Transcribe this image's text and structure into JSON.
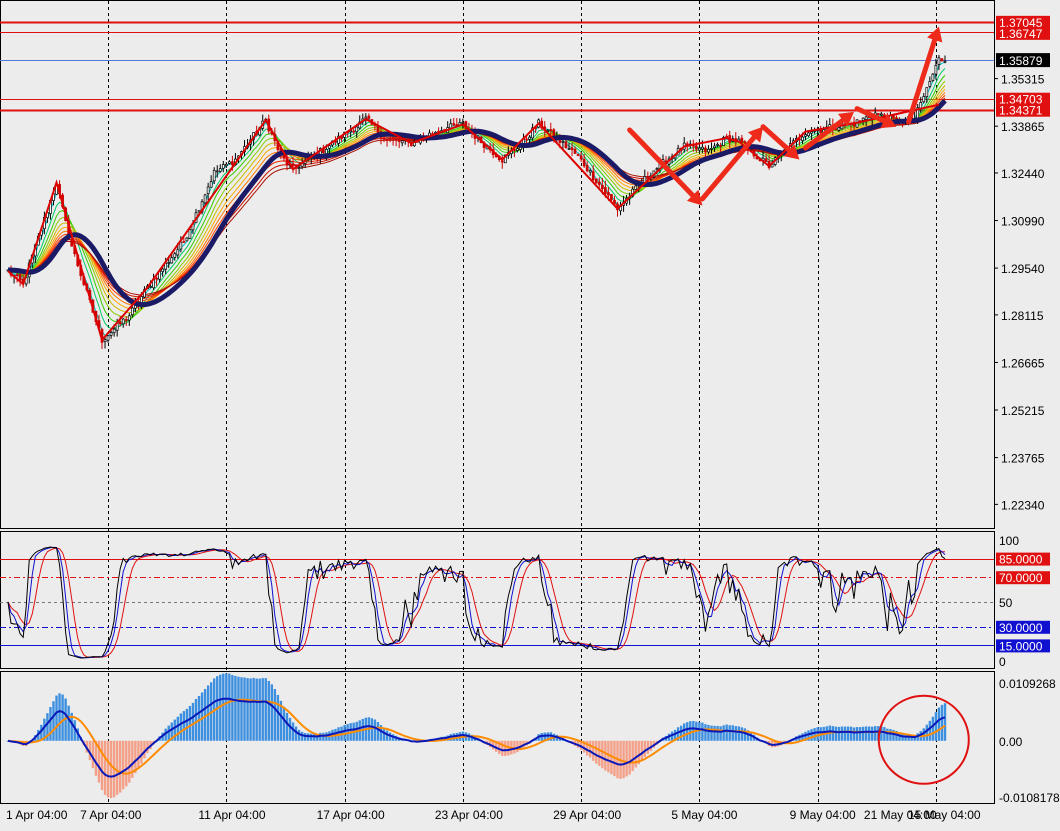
{
  "colors": {
    "background": "#ececec",
    "up_candle": "#000000",
    "down_candle": "#cc0000",
    "slow_ma": "#1a1a66",
    "zigzag": "#dd0000",
    "arrows": "#ee2a1a",
    "histogram_pos": "#3d8fe0",
    "histogram_neg": "#f4a088",
    "macd_line": "#0a18b8",
    "signal_line": "#ff8c00",
    "level_red": "#e01010",
    "level_blue": "#1010d0"
  },
  "price_panel": {
    "ylim": [
      1.2165,
      1.3765
    ],
    "tick_labels": [
      "1.35315",
      "1.33865",
      "1.32440",
      "1.30990",
      "1.29540",
      "1.28115",
      "1.26665",
      "1.25215",
      "1.23765",
      "1.22340"
    ],
    "tick_values": [
      1.35315,
      1.33865,
      1.3244,
      1.3099,
      1.2954,
      1.28115,
      1.26665,
      1.25215,
      1.23765,
      1.2234
    ],
    "current_price": {
      "label": "1.35879",
      "value": 1.35879
    },
    "levels": [
      {
        "label": "1.37045",
        "value": 1.37045
      },
      {
        "label": "1.36747",
        "value": 1.36747
      },
      {
        "label": "1.34703",
        "value": 1.34703
      },
      {
        "label": "1.34371",
        "value": 1.34371
      }
    ],
    "zigzag": [
      [
        0,
        1.2945
      ],
      [
        5,
        1.2905
      ],
      [
        16,
        1.3215
      ],
      [
        31,
        1.2735
      ],
      [
        46,
        1.2895
      ],
      [
        85,
        1.3405
      ],
      [
        94,
        1.3255
      ],
      [
        118,
        1.3408
      ],
      [
        133,
        1.3335
      ],
      [
        150,
        1.3392
      ],
      [
        163,
        1.3285
      ],
      [
        175,
        1.3395
      ],
      [
        201,
        1.3135
      ],
      [
        223,
        1.3325
      ],
      [
        237,
        1.335
      ],
      [
        241,
        1.334
      ],
      [
        251,
        1.3265
      ],
      [
        263,
        1.337
      ],
      [
        279,
        1.3395
      ],
      [
        307,
        1.3452
      ]
    ],
    "arrows": [
      [
        1.3375,
        1.3145
      ],
      [
        1.3165,
        1.3385
      ],
      [
        1.3385,
        1.3285
      ],
      [
        1.332,
        1.343
      ],
      [
        1.344,
        1.3385
      ],
      [
        1.34,
        1.369
      ]
    ]
  },
  "stoch_panel": {
    "ylim": [
      0,
      100
    ],
    "labels": {
      "top": "100",
      "mid": "50",
      "bottom": "0"
    },
    "levels": [
      {
        "label": "85.0000",
        "value": 85
      },
      {
        "label": "70.0000",
        "value": 70
      },
      {
        "label": "30.0000",
        "value": 30
      },
      {
        "label": "15.0000",
        "value": 15
      }
    ]
  },
  "macd_panel": {
    "ylim": [
      -0.0108178,
      0.0109268
    ],
    "labels": [
      {
        "label": "0.0109268",
        "value": 0.0109268
      },
      {
        "label": "0.00",
        "value": 0
      },
      {
        "label": "-0.0108178",
        "value": -0.0108178
      }
    ]
  },
  "x_axis": {
    "labels": [
      "1 Apr 04:00",
      "7 Apr 04:00",
      "11 Apr 04:00",
      "17 Apr 04:00",
      "23 Apr 04:00",
      "29 Apr 04:00",
      "5 May 04:00",
      "9 May 04:00",
      "15 May 04:00",
      "21 May 04:00"
    ],
    "grid_bars": [
      33,
      72,
      111,
      150,
      189,
      228,
      267,
      306
    ],
    "label_bars": [
      -0.5,
      33,
      72,
      111,
      150,
      189,
      228,
      267,
      306
    ]
  },
  "chart_data": {
    "type": "candlestick",
    "title": "",
    "x_tick_labels": [
      "1 Apr 04:00",
      "7 Apr 04:00",
      "11 Apr 04:00",
      "17 Apr 04:00",
      "23 Apr 04:00",
      "29 Apr 04:00",
      "5 May 04:00",
      "9 May 04:00",
      "15 May 04:00",
      "21 May 04:00"
    ],
    "y_range": [
      1.2234,
      1.37045
    ],
    "bars": 310,
    "price_anchors": [
      [
        0,
        1.2945
      ],
      [
        5,
        1.2905
      ],
      [
        16,
        1.3215
      ],
      [
        20,
        1.305
      ],
      [
        31,
        1.2735
      ],
      [
        40,
        1.281
      ],
      [
        46,
        1.2895
      ],
      [
        58,
        1.3035
      ],
      [
        68,
        1.3245
      ],
      [
        75,
        1.3285
      ],
      [
        85,
        1.3405
      ],
      [
        90,
        1.3295
      ],
      [
        94,
        1.3255
      ],
      [
        104,
        1.3315
      ],
      [
        118,
        1.3408
      ],
      [
        125,
        1.3345
      ],
      [
        133,
        1.3335
      ],
      [
        142,
        1.3375
      ],
      [
        150,
        1.3392
      ],
      [
        156,
        1.334
      ],
      [
        163,
        1.3285
      ],
      [
        170,
        1.334
      ],
      [
        175,
        1.3395
      ],
      [
        188,
        1.3295
      ],
      [
        201,
        1.3135
      ],
      [
        212,
        1.3245
      ],
      [
        223,
        1.3325
      ],
      [
        231,
        1.331
      ],
      [
        237,
        1.335
      ],
      [
        241,
        1.334
      ],
      [
        251,
        1.3265
      ],
      [
        263,
        1.337
      ],
      [
        279,
        1.3395
      ],
      [
        286,
        1.3425
      ],
      [
        293,
        1.34
      ],
      [
        299,
        1.341
      ],
      [
        307,
        1.359
      ]
    ],
    "indicators": [
      "moving average ribbon",
      "stochastic oscillator",
      "MACD histogram"
    ]
  }
}
